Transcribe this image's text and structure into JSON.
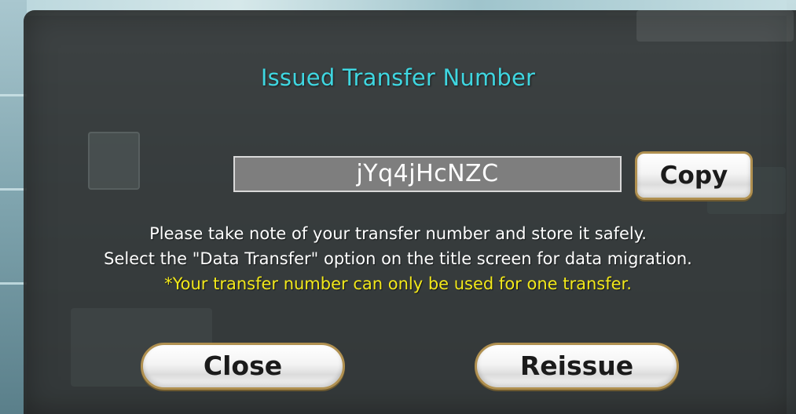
{
  "dialog": {
    "title": "Issued Transfer Number",
    "transfer_number": "jYq4jHcNZC",
    "copy_label": "Copy",
    "message_line_1": "Please take note of your transfer number and store it safely.",
    "message_line_2": "Select the \"Data Transfer\" option on the title screen for data migration.",
    "warning": "*Your transfer number can only be used for one transfer.",
    "close_label": "Close",
    "reissue_label": "Reissue"
  },
  "colors": {
    "title": "#3fd6e0",
    "warning": "#f2e81a",
    "panel": "#303232",
    "button_border": "#b09050"
  }
}
